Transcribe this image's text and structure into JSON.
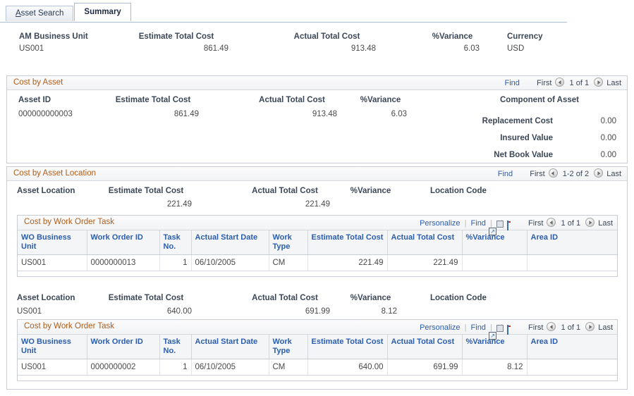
{
  "tabs": [
    {
      "label_pre": "",
      "label_accesskey": "A",
      "label_post": "sset Search",
      "label": "Asset Search",
      "active": false
    },
    {
      "label": "Summary",
      "active": true
    }
  ],
  "summary_header": {
    "columns": [
      {
        "label": "AM Business Unit",
        "value": "US001",
        "align": "left"
      },
      {
        "label": "Estimate Total Cost",
        "value": "861.49",
        "align": "right"
      },
      {
        "label": "Actual Total Cost",
        "value": "913.48",
        "align": "right"
      },
      {
        "label": "%Variance",
        "value": "6.03",
        "align": "right"
      },
      {
        "label": "Currency",
        "value": "USD",
        "align": "left"
      }
    ]
  },
  "cost_by_asset": {
    "title": "Cost by Asset",
    "nav": {
      "find": "Find",
      "first": "First",
      "counter": "1 of 1",
      "last": "Last",
      "prev_icon": "prev-arrow-icon",
      "next_icon": "next-arrow-icon"
    },
    "labels": {
      "asset_id": "Asset ID",
      "estimate_total_cost": "Estimate Total Cost",
      "actual_total_cost": "Actual Total Cost",
      "variance": "%Variance",
      "component_of_asset": "Component of Asset",
      "replacement_cost": "Replacement Cost",
      "insured_value": "Insured Value",
      "net_book_value": "Net Book Value"
    },
    "values": {
      "asset_id": "000000000003",
      "estimate_total_cost": "861.49",
      "actual_total_cost": "913.48",
      "variance": "6.03",
      "replacement_cost": "0.00",
      "insured_value": "0.00",
      "net_book_value": "0.00"
    }
  },
  "cost_by_asset_location": {
    "title": "Cost by Asset Location",
    "nav": {
      "find": "Find",
      "first": "First",
      "counter": "1-2 of 2",
      "last": "Last"
    },
    "labels": {
      "asset_location": "Asset Location",
      "estimate_total_cost": "Estimate Total Cost",
      "actual_total_cost": "Actual Total Cost",
      "variance": "%Variance",
      "location_code": "Location Code"
    },
    "rows": [
      {
        "asset_location": "",
        "estimate_total_cost": "221.49",
        "actual_total_cost": "221.49",
        "variance": "",
        "location_code": ""
      },
      {
        "asset_location": "US001",
        "estimate_total_cost": "640.00",
        "actual_total_cost": "691.99",
        "variance": "8.12",
        "location_code": ""
      }
    ]
  },
  "work_order_grids": [
    {
      "title": "Cost by Work Order Task",
      "toolbar": {
        "personalize": "Personalize",
        "find": "Find",
        "expand_icon": "expand-window-icon",
        "download_icon": "download-grid-icon",
        "first": "First",
        "counter": "1 of 1",
        "last": "Last"
      },
      "columns": [
        "WO Business Unit",
        "Work Order ID",
        "Task No.",
        "Actual Start Date",
        "Work Type",
        "Estimate Total Cost",
        "Actual Total Cost",
        "%Variance",
        "Area ID"
      ],
      "rows": [
        {
          "wo_business_unit": "US001",
          "work_order_id": "0000000013",
          "task_no": "1",
          "actual_start_date": "06/10/2005",
          "work_type": "CM",
          "estimate_total_cost": "221.49",
          "actual_total_cost": "221.49",
          "variance": "",
          "area_id": ""
        }
      ]
    },
    {
      "title": "Cost by Work Order Task",
      "toolbar": {
        "personalize": "Personalize",
        "find": "Find",
        "expand_icon": "expand-window-icon",
        "download_icon": "download-grid-icon",
        "first": "First",
        "counter": "1 of 1",
        "last": "Last"
      },
      "columns": [
        "WO Business Unit",
        "Work Order ID",
        "Task No.",
        "Actual Start Date",
        "Work Type",
        "Estimate Total Cost",
        "Actual Total Cost",
        "%Variance",
        "Area ID"
      ],
      "rows": [
        {
          "wo_business_unit": "US001",
          "work_order_id": "0000000002",
          "task_no": "1",
          "actual_start_date": "06/10/2005",
          "work_type": "CM",
          "estimate_total_cost": "640.00",
          "actual_total_cost": "691.99",
          "variance": "8.12",
          "area_id": ""
        }
      ]
    }
  ],
  "colors": {
    "group_title": "#b05c18",
    "link": "#2a5db0",
    "label": "#3b4757",
    "value": "#4a4a4a"
  }
}
